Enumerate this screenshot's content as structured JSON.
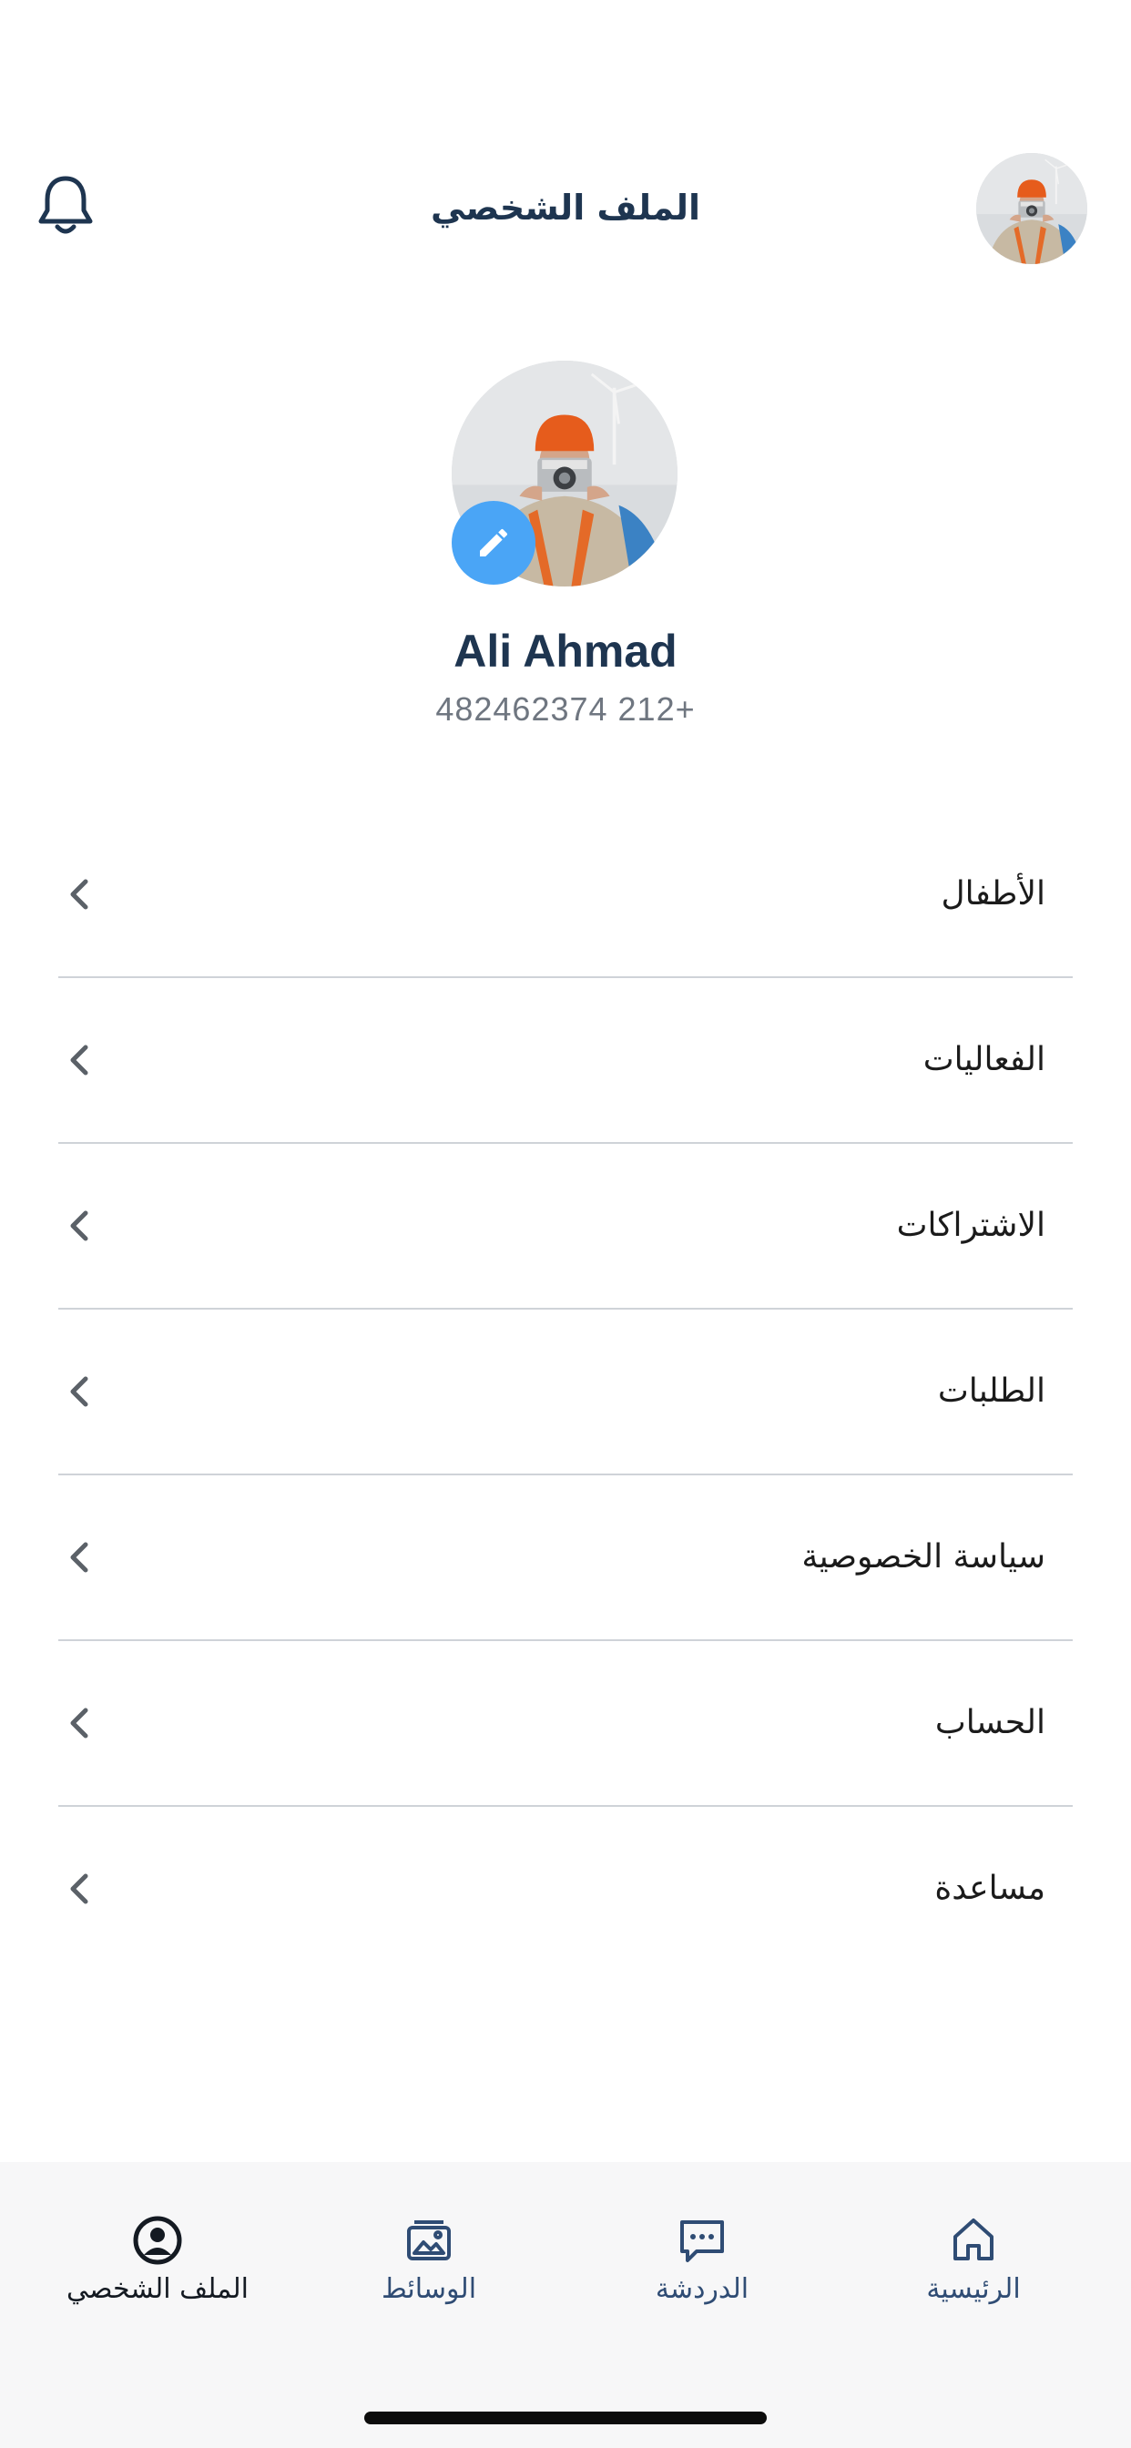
{
  "header": {
    "title": "الملف الشخصي",
    "notification_icon": "bell-icon",
    "avatar_icon": "user-photo"
  },
  "profile": {
    "name": "Ali Ahmad",
    "phone": "482462374 212+",
    "edit_icon": "pencil-icon"
  },
  "menu": {
    "items": [
      {
        "label": "الأطفال"
      },
      {
        "label": "الفعاليات"
      },
      {
        "label": "الاشتراكات"
      },
      {
        "label": "الطلبات"
      },
      {
        "label": "سياسة الخصوصية"
      },
      {
        "label": "الحساب"
      },
      {
        "label": "مساعدة"
      }
    ],
    "chevron_icon": "chevron-left-icon"
  },
  "tabbar": {
    "tabs": [
      {
        "label": "الملف الشخصي",
        "icon": "user-circle-icon",
        "active": true
      },
      {
        "label": "الوسائط",
        "icon": "media-icon",
        "active": false
      },
      {
        "label": "الدردشة",
        "icon": "chat-icon",
        "active": false
      },
      {
        "label": "الرئيسية",
        "icon": "home-icon",
        "active": false
      }
    ]
  },
  "colors": {
    "primary_text": "#1e3550",
    "accent": "#4aa5f6",
    "tab_inactive": "#2f4c74",
    "tabbar_bg": "#f7f7f8",
    "divider": "#cfd3d8"
  }
}
